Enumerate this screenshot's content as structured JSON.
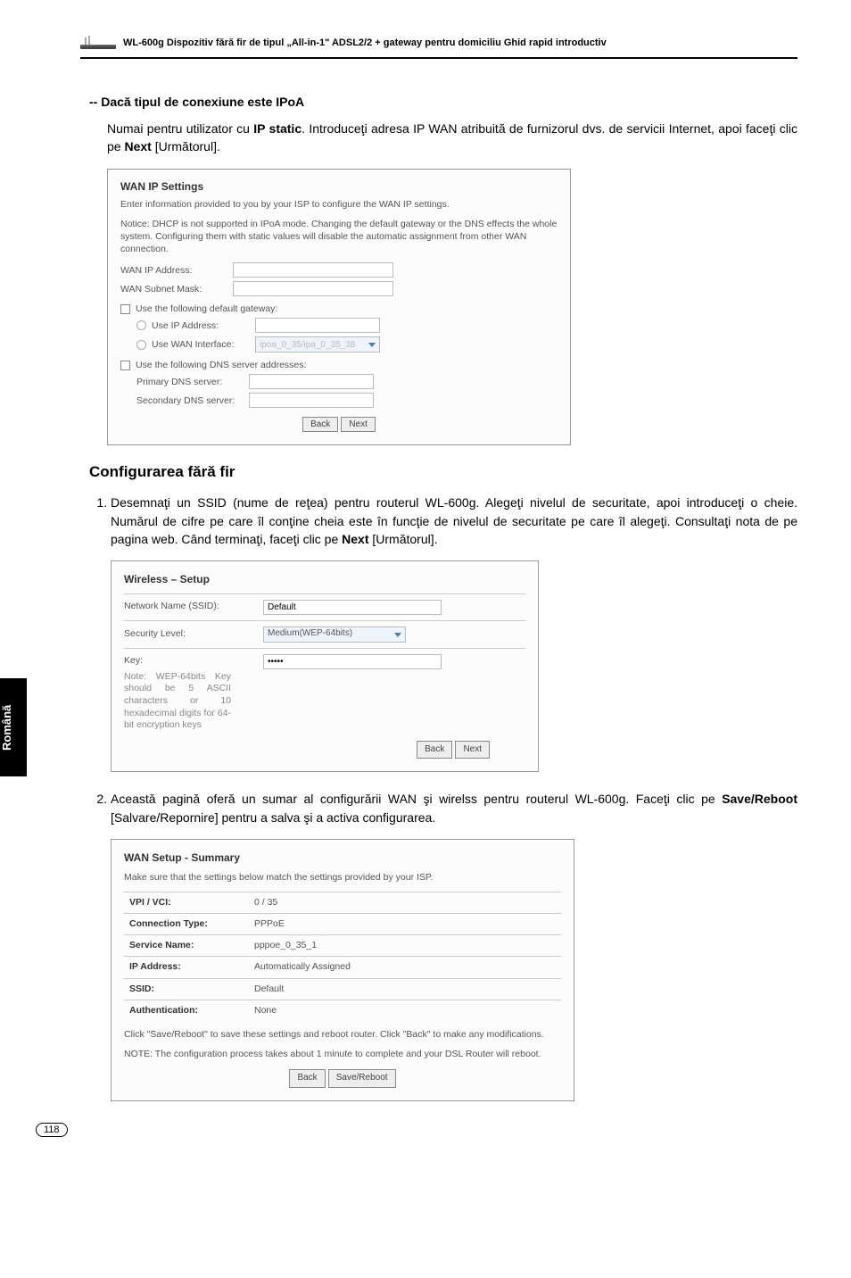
{
  "header": {
    "product_line": "WL-600g Dispozitiv fără fir de tipul „All-in-1\" ADSL2/2 + gateway pentru domiciliu Ghid rapid introductiv"
  },
  "sidebar_tab": "Română",
  "ipoa": {
    "heading": "-- Dacă tipul de conexiune este IPoA",
    "para_1_a": "Numai pentru utilizator cu ",
    "para_1_b": "IP static",
    "para_1_c": ". Introduceţi adresa IP WAN atribuită de furnizorul dvs. de servicii Internet, apoi faceţi clic pe ",
    "para_1_d": "Next",
    "para_1_e": " [Următorul]."
  },
  "panel1": {
    "title": "WAN IP Settings",
    "intro": "Enter information provided to you by your ISP to configure the WAN IP settings.",
    "notice": "Notice: DHCP is not supported in IPoA mode. Changing the default gateway or the DNS effects the whole system. Configuring them with static values will disable the automatic assignment from other WAN connection.",
    "wan_ip_label": "WAN IP Address:",
    "subnet_label": "WAN Subnet Mask:",
    "use_gw_label": "Use the following default gateway:",
    "use_ip_label": "Use IP Address:",
    "use_wan_if_label": "Use WAN Interface:",
    "use_wan_if_value": "ipoa_0_35/ipa_0_35_38",
    "use_dns_label": "Use the following DNS server addresses:",
    "primary_dns_label": "Primary DNS server:",
    "secondary_dns_label": "Secondary DNS server:",
    "back": "Back",
    "next": "Next"
  },
  "wireless": {
    "heading": "Configurarea fără fir",
    "step1_a": "Desemnaţi un SSID (nume de reţea) pentru routerul WL-600g. Alegeţi nivelul de securitate, apoi introduceţi o cheie. Numărul de cifre pe care îl conţine cheia este în funcţie de nivelul de securitate pe care îl alegeţi. Consultaţi nota de pe pagina web. Când terminaţi, faceţi clic pe ",
    "step1_b": "Next",
    "step1_c": " [Următorul].",
    "step2_a": "Această pagină oferă un sumar al configurării WAN şi wirelss pentru routerul WL-600g. Faceţi clic pe ",
    "step2_b": "Save/Reboot",
    "step2_c": " [Salvare/Repornire] pentru a salva şi a activa configurarea."
  },
  "panel2": {
    "title": "Wireless – Setup",
    "ssid_label": "Network Name (SSID):",
    "ssid_value": "Default",
    "sec_label": "Security Level:",
    "sec_value": "Medium(WEP-64bits)",
    "key_label": "Key:",
    "key_value": "•••••",
    "note": "Note: WEP-64bits Key should be 5 ASCII characters or 10 hexadecimal digits for 64-bit encryption keys",
    "back": "Back",
    "next": "Next"
  },
  "panel3": {
    "title": "WAN Setup - Summary",
    "intro": "Make sure that the settings below match the settings provided by your ISP.",
    "rows": {
      "vpi_vci_label": "VPI / VCI:",
      "vpi_vci": "0 / 35",
      "conn_type_label": "Connection Type:",
      "conn_type": "PPPoE",
      "svc_name_label": "Service Name:",
      "svc_name": "pppoe_0_35_1",
      "ip_addr_label": "IP Address:",
      "ip_addr": "Automatically Assigned",
      "ssid_label": "SSID:",
      "ssid": "Default",
      "auth_label": "Authentication:",
      "auth": "None"
    },
    "footer1": "Click \"Save/Reboot\" to save these settings and reboot router. Click \"Back\" to make any modifications.",
    "footer2": "NOTE: The configuration process takes about 1 minute to complete and your DSL Router will reboot.",
    "back": "Back",
    "save": "Save/Reboot"
  },
  "page_number": "118"
}
